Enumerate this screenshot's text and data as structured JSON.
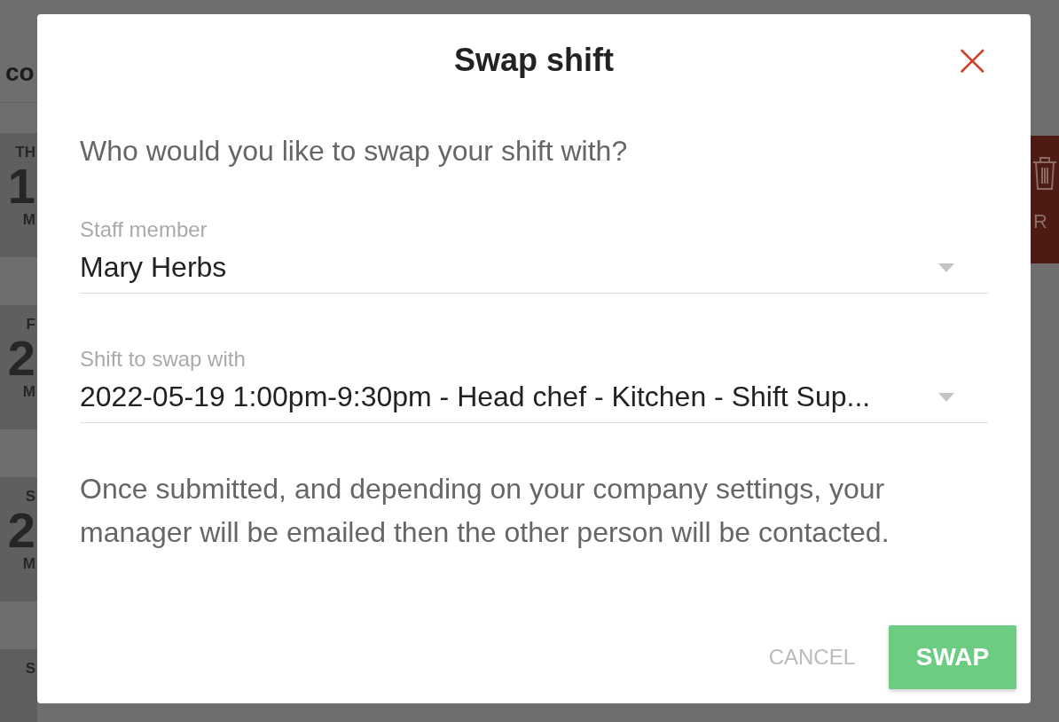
{
  "background": {
    "header_text": "co",
    "days": [
      {
        "weekday": "TH",
        "day": "1",
        "month": "M"
      },
      {
        "weekday": "F",
        "day": "2",
        "month": "M"
      },
      {
        "weekday": "S",
        "day": "2",
        "month": "M"
      },
      {
        "weekday": "S"
      }
    ],
    "side_button": {
      "label": "R"
    }
  },
  "dialog": {
    "title": "Swap shift",
    "close": "×",
    "question": "Who would you like to swap your shift with?",
    "fields": [
      {
        "label": "Staff member",
        "value": "Mary Herbs"
      },
      {
        "label": "Shift to swap with",
        "value": "2022-05-19 1:00pm-9:30pm - Head chef - Kitchen - Shift Sup..."
      }
    ],
    "note": "Once submitted, and depending on your company settings, your manager will be emailed then the other person will be contacted.",
    "buttons": [
      {
        "label": "CANCEL",
        "kind": "text"
      },
      {
        "label": "SWAP",
        "kind": "primary"
      }
    ]
  }
}
